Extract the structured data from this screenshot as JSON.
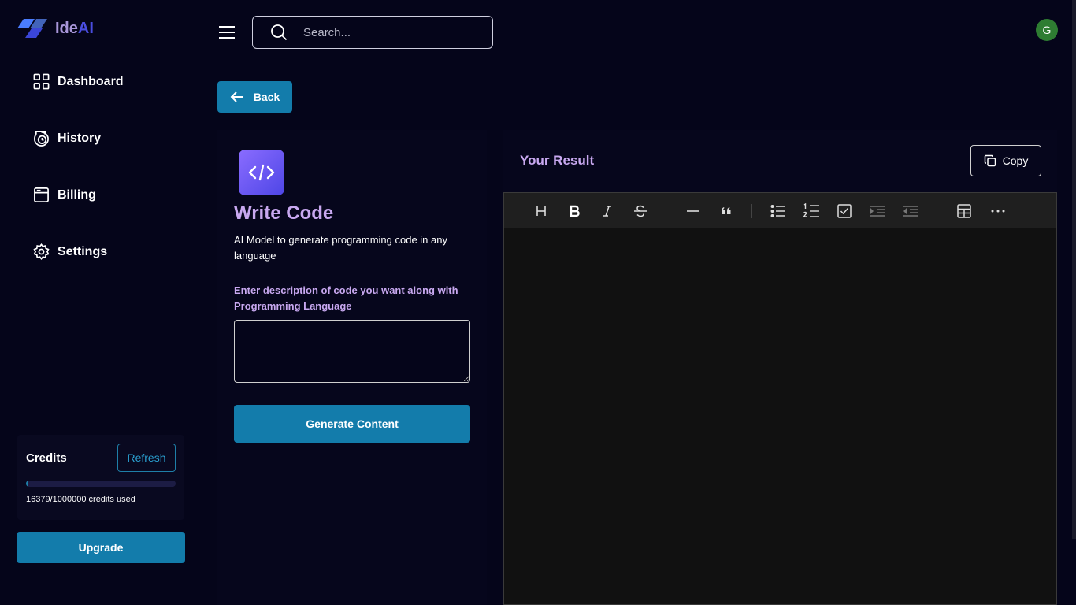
{
  "app": {
    "name_part1": "Ide",
    "name_part2": "AI"
  },
  "sidebar": {
    "items": [
      {
        "label": "Dashboard",
        "icon": "dashboard-icon"
      },
      {
        "label": "History",
        "icon": "history-icon"
      },
      {
        "label": "Billing",
        "icon": "billing-icon"
      },
      {
        "label": "Settings",
        "icon": "settings-icon"
      }
    ],
    "credits": {
      "title": "Credits",
      "refresh_label": "Refresh",
      "used": 16379,
      "total": 1000000,
      "usage_fraction": 0.016379,
      "usage_text": "16379/1000000 credits used"
    },
    "upgrade_label": "Upgrade"
  },
  "header": {
    "search_placeholder": "Search...",
    "avatar_initial": "G"
  },
  "back_label": "Back",
  "tool": {
    "title": "Write Code",
    "description": "AI Model to generate programming code in any language",
    "input_label": "Enter description of code you want along with Programming Language",
    "input_value": "",
    "generate_label": "Generate Content",
    "icon": "code-icon"
  },
  "result": {
    "title": "Your Result",
    "copy_label": "Copy",
    "toolbar": [
      "heading-icon",
      "bold-icon",
      "italic-icon",
      "strikethrough-icon",
      "horizontal-rule-icon",
      "blockquote-icon",
      "bullet-list-icon",
      "ordered-list-icon",
      "task-list-icon",
      "indent-icon",
      "outdent-icon",
      "table-icon",
      "more-icon"
    ]
  },
  "colors": {
    "background": "#05051a",
    "accent": "#137cab",
    "title_purple": "#c8a8f0",
    "avatar_green": "#2e7d32"
  }
}
